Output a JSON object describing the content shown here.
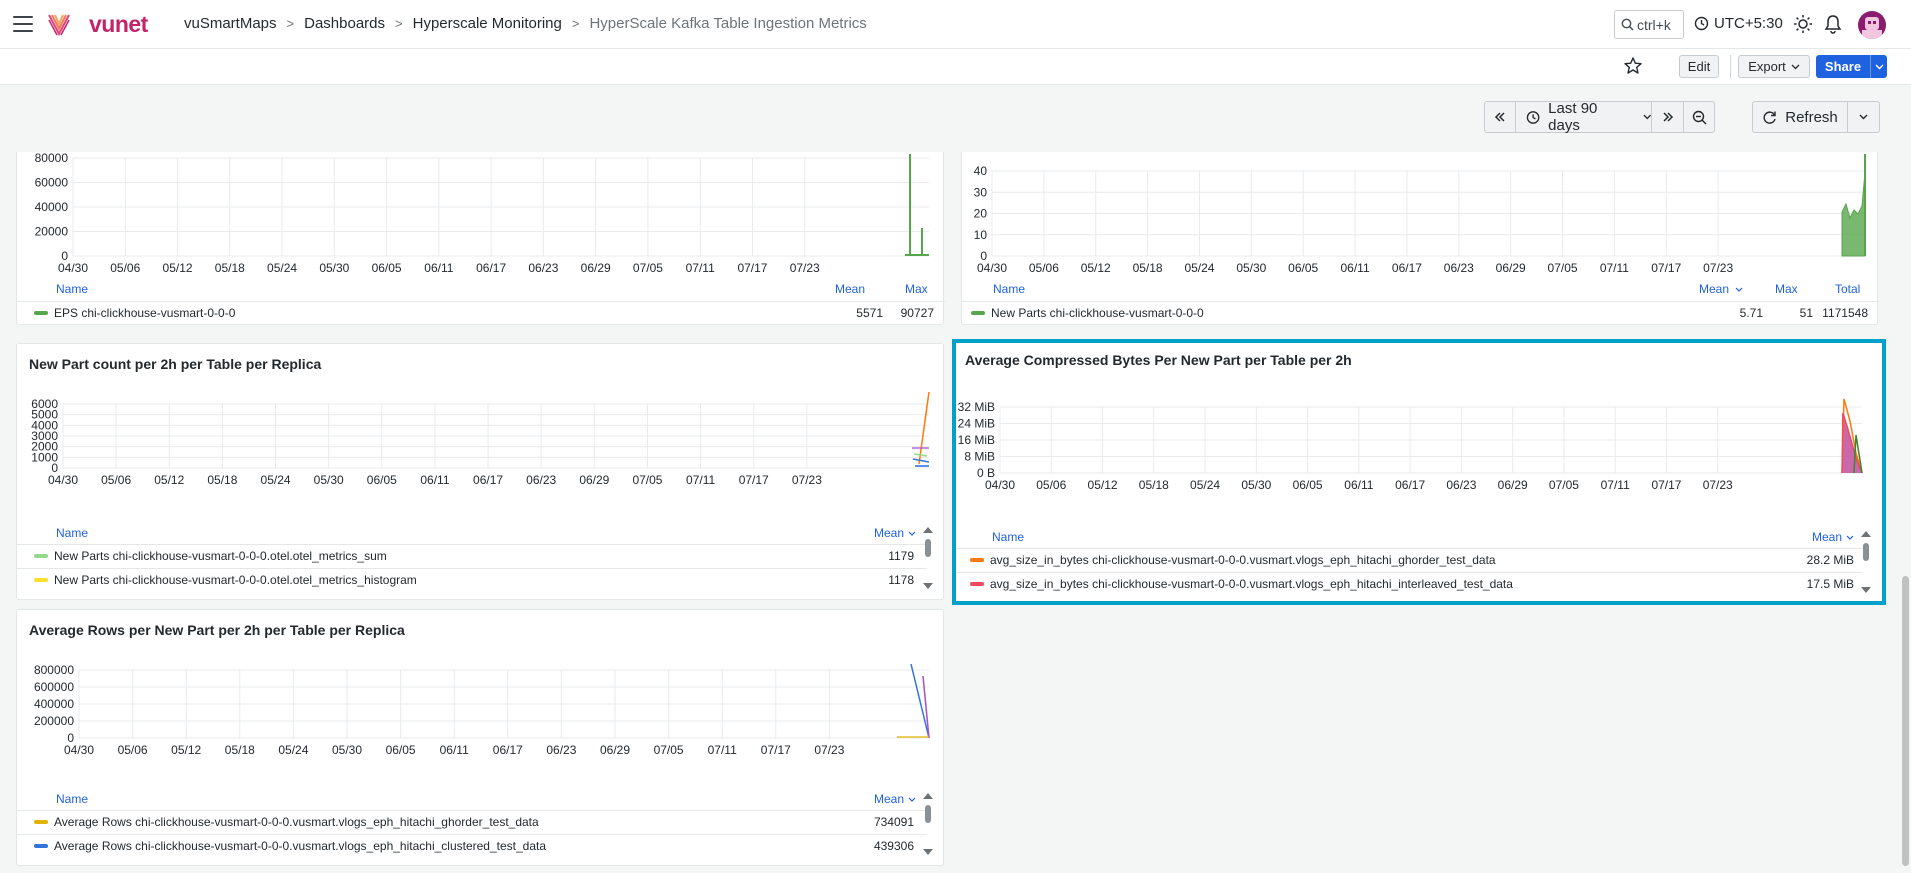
{
  "topbar": {
    "brand": "vunet",
    "breadcrumb": [
      "vuSmartMaps",
      "Dashboards",
      "Hyperscale Monitoring",
      "HyperScale Kafka Table Ingestion Metrics"
    ],
    "search_placeholder": "ctrl+k",
    "timezone": "UTC+5:30"
  },
  "toolbar": {
    "edit_label": "Edit",
    "export_label": "Export",
    "share_label": "Share"
  },
  "timepicker": {
    "range_label": "Last 90 days",
    "refresh_label": "Refresh"
  },
  "colors": {
    "accent": "#1f62e0",
    "selection": "#00a3c7",
    "green": "#56a64b",
    "orange": "#ff780a",
    "red": "#f2495c",
    "yellow": "#fade2a",
    "lightgreen": "#96d98d",
    "blue": "#3274d9",
    "purple": "#a352cc",
    "olive": "#e0b400"
  },
  "x_ticks": [
    "04/30",
    "05/06",
    "05/12",
    "05/18",
    "05/24",
    "05/30",
    "06/05",
    "06/11",
    "06/17",
    "06/23",
    "06/29",
    "07/05",
    "07/11",
    "07/17",
    "07/23"
  ],
  "panels": {
    "eps": {
      "y_ticks": [
        "80000",
        "60000",
        "40000",
        "20000",
        "0"
      ],
      "legend_header": {
        "name": "Name",
        "c1": "Mean",
        "c2": "Max"
      },
      "rows": [
        {
          "name": "EPS chi-clickhouse-vusmart-0-0-0",
          "c1": "5571",
          "c2": "90727",
          "color": "#56a64b"
        }
      ]
    },
    "new_parts": {
      "y_ticks": [
        "40",
        "30",
        "20",
        "10",
        "0"
      ],
      "legend_header": {
        "name": "Name",
        "c1": "Mean",
        "c2": "Max",
        "c3": "Total"
      },
      "rows": [
        {
          "name": "New Parts chi-clickhouse-vusmart-0-0-0",
          "c1": "5.71",
          "c2": "51",
          "c3": "1171548",
          "color": "#56a64b"
        }
      ]
    },
    "part_count": {
      "title": "New Part count per 2h per Table per Replica",
      "y_ticks": [
        "6000",
        "5000",
        "4000",
        "3000",
        "2000",
        "1000",
        "0"
      ],
      "legend_header": {
        "name": "Name",
        "c1": "Mean"
      },
      "rows": [
        {
          "name": "New Parts chi-clickhouse-vusmart-0-0-0.otel.otel_metrics_sum",
          "c1": "1179",
          "color": "#96d98d"
        },
        {
          "name": "New Parts chi-clickhouse-vusmart-0-0-0.otel.otel_metrics_histogram",
          "c1": "1178",
          "color": "#fade2a"
        }
      ]
    },
    "compressed": {
      "title": "Average Compressed Bytes Per New Part per Table per 2h",
      "y_ticks": [
        "32 MiB",
        "24 MiB",
        "16 MiB",
        "8 MiB",
        "0 B"
      ],
      "legend_header": {
        "name": "Name",
        "c1": "Mean"
      },
      "rows": [
        {
          "name": "avg_size_in_bytes chi-clickhouse-vusmart-0-0-0.vusmart.vlogs_eph_hitachi_ghorder_test_data",
          "c1": "28.2 MiB",
          "color": "#ff780a"
        },
        {
          "name": "avg_size_in_bytes chi-clickhouse-vusmart-0-0-0.vusmart.vlogs_eph_hitachi_interleaved_test_data",
          "c1": "17.5 MiB",
          "color": "#f2495c"
        }
      ]
    },
    "avg_rows": {
      "title": "Average Rows per New Part per 2h per Table per Replica",
      "y_ticks": [
        "800000",
        "600000",
        "400000",
        "200000",
        "0"
      ],
      "legend_header": {
        "name": "Name",
        "c1": "Mean"
      },
      "rows": [
        {
          "name": "Average Rows chi-clickhouse-vusmart-0-0-0.vusmart.vlogs_eph_hitachi_ghorder_test_data",
          "c1": "734091",
          "color": "#e0b400"
        },
        {
          "name": "Average Rows chi-clickhouse-vusmart-0-0-0.vusmart.vlogs_eph_hitachi_clustered_test_data",
          "c1": "439306",
          "color": "#3274d9"
        }
      ]
    }
  }
}
